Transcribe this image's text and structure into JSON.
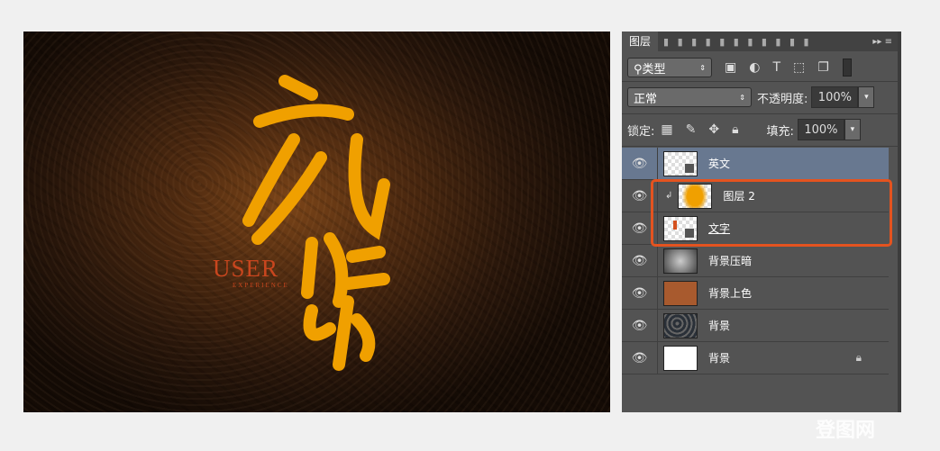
{
  "artwork": {
    "english_text": "USER",
    "english_subtext": "EXPERIENCE",
    "calligraphy_color": "#f0a000"
  },
  "panel": {
    "tab": "图层",
    "filter": {
      "label": "类型",
      "icons": [
        "image-filter-icon",
        "adjustment-filter-icon",
        "text-filter-icon",
        "shape-filter-icon",
        "smart-object-filter-icon"
      ]
    },
    "blend_mode": "正常",
    "opacity_label": "不透明度:",
    "opacity": "100%",
    "lock_label": "锁定:",
    "fill_label": "填充:",
    "fill": "100%",
    "layers": [
      {
        "name": "英文",
        "active": true,
        "thumb": "smart"
      },
      {
        "name": "图层 2",
        "clipped": true,
        "thumb": "orange"
      },
      {
        "name": "文字",
        "thumb": "smart-red"
      },
      {
        "name": "背景压暗",
        "thumb": "gradient"
      },
      {
        "name": "背景上色",
        "thumb": "brown",
        "color": "#a85a2e"
      },
      {
        "name": "背景",
        "thumb": "texture"
      },
      {
        "name": "背景",
        "thumb": "white",
        "locked": true
      }
    ]
  },
  "highlight_color": "#e4531f",
  "watermark": "登图网"
}
